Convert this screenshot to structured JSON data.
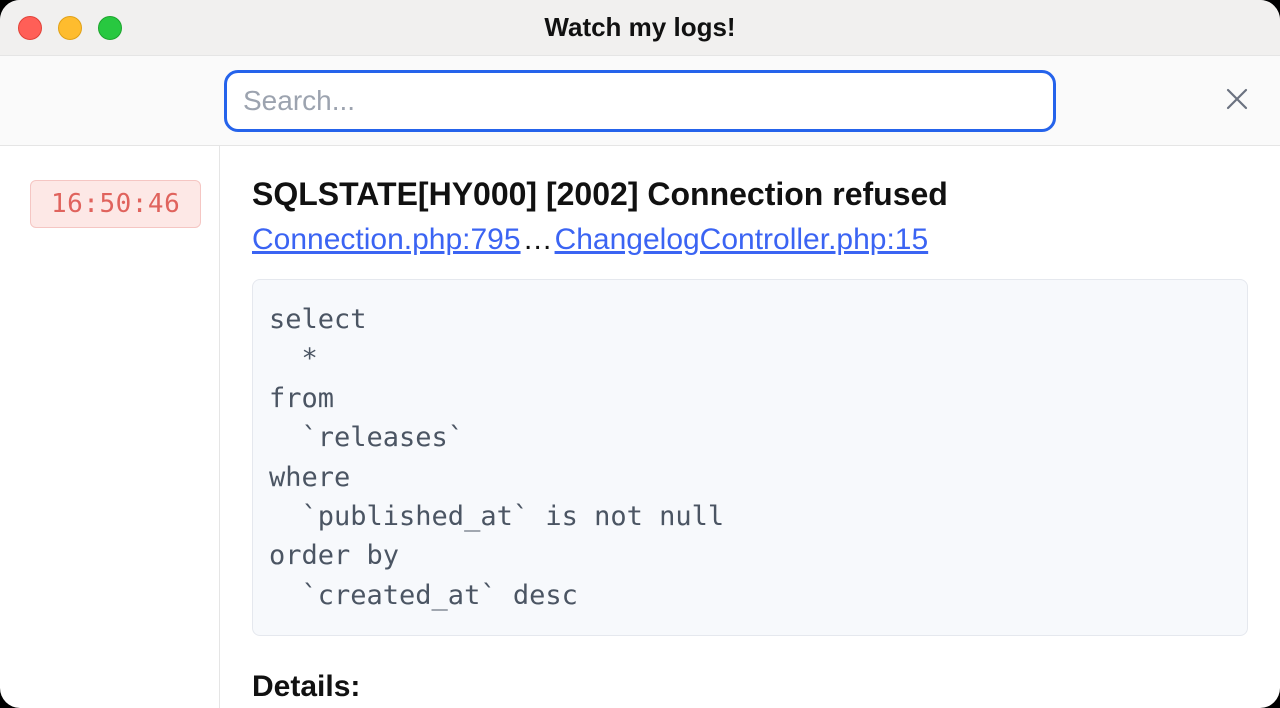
{
  "window": {
    "title": "Watch my logs!"
  },
  "search": {
    "placeholder": "Search...",
    "value": ""
  },
  "log": {
    "timestamp": "16:50:46",
    "title": "SQLSTATE[HY000] [2002] Connection refused",
    "trace": {
      "link1": "Connection.php:795",
      "sep": "…",
      "link2": "ChangelogController.php:15"
    },
    "sql": "select\n  *\nfrom\n  `releases`\nwhere\n  `published_at` is not null\norder by\n  `created_at` desc",
    "details_heading": "Details:"
  }
}
